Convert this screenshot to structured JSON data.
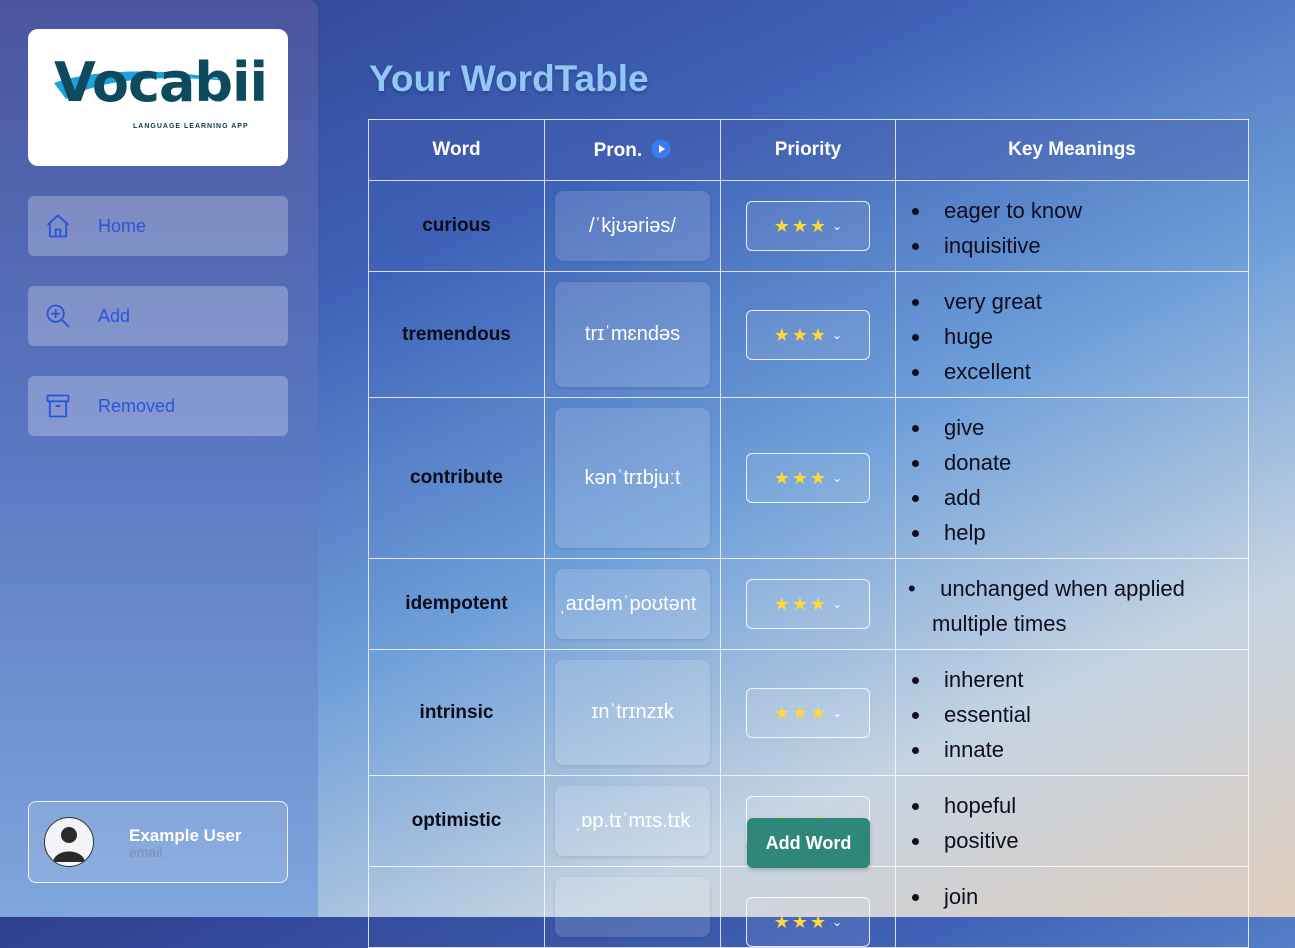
{
  "app": {
    "logo_text": "Vocabii",
    "logo_tagline": "LANGUAGE LEARNING APP"
  },
  "sidebar": {
    "items": [
      {
        "label": "Home",
        "icon": "home-icon"
      },
      {
        "label": "Add",
        "icon": "zoom-plus-icon"
      },
      {
        "label": "Removed",
        "icon": "archive-icon"
      }
    ]
  },
  "user": {
    "name": "Example User",
    "email": "email",
    "icon": "user-avatar-icon"
  },
  "page": {
    "title": "Your WordTable"
  },
  "table": {
    "headers": {
      "word": "Word",
      "pron": "Pron.",
      "priority": "Priority",
      "meanings": "Key Meanings"
    },
    "pron_icon": "play-circle-icon",
    "rows": [
      {
        "word": "curious",
        "pron": "/ˈkjʊəriəs/",
        "priority": 3,
        "meanings": [
          "eager to know",
          "inquisitive"
        ]
      },
      {
        "word": "tremendous",
        "pron": "trɪˈmɛndəs",
        "priority": 3,
        "meanings": [
          "very great",
          "huge",
          "excellent"
        ]
      },
      {
        "word": "contribute",
        "pron": "kənˈtrɪbjuːt",
        "priority": 3,
        "meanings": [
          "give",
          "donate",
          "add",
          "help"
        ]
      },
      {
        "word": "idempotent",
        "pron": "ˌaɪdəmˈpoʊtənt",
        "priority": 3,
        "meanings": [
          "unchanged when applied multiple times"
        ]
      },
      {
        "word": "intrinsic",
        "pron": "ɪnˈtrɪnzɪk",
        "priority": 3,
        "meanings": [
          "inherent",
          "essential",
          "innate"
        ]
      },
      {
        "word": "optimistic",
        "pron": "ˌɒp.tɪˈmɪs.tɪk",
        "priority": 3,
        "meanings": [
          "hopeful",
          "positive"
        ]
      },
      {
        "word": "",
        "pron": "",
        "priority": 3,
        "meanings": [
          "join"
        ]
      }
    ]
  },
  "actions": {
    "add_word": "Add Word"
  },
  "colors": {
    "accent": "#2b55d9",
    "button": "#2e8778",
    "title": "#92c8f7",
    "star": "#ffd83a"
  }
}
